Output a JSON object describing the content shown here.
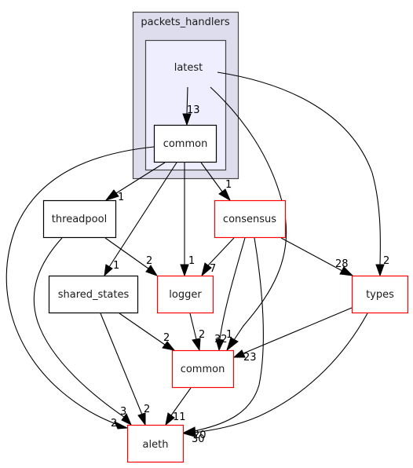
{
  "diagram": {
    "type": "directory-dependency-graph",
    "clusters": [
      {
        "id": "packets_handlers",
        "label": "packets_handlers",
        "fill": "#ddddee"
      },
      {
        "id": "latest",
        "label": "latest",
        "fill": "#eeeeff",
        "parent": "packets_handlers"
      }
    ],
    "nodes": [
      {
        "id": "common_inner",
        "label": "common",
        "border": "#000000",
        "cluster": "latest"
      },
      {
        "id": "threadpool",
        "label": "threadpool",
        "border": "#000000"
      },
      {
        "id": "consensus",
        "label": "consensus",
        "border": "#ff0000"
      },
      {
        "id": "shared_states",
        "label": "shared_states",
        "border": "#000000"
      },
      {
        "id": "logger",
        "label": "logger",
        "border": "#ff0000"
      },
      {
        "id": "types",
        "label": "types",
        "border": "#ff0000"
      },
      {
        "id": "common",
        "label": "common",
        "border": "#ff0000"
      },
      {
        "id": "aleth",
        "label": "aleth",
        "border": "#ff0000"
      }
    ],
    "edges": [
      {
        "from": "latest",
        "to": "common_inner",
        "label": "13"
      },
      {
        "from": "latest",
        "to": "types",
        "label": "2"
      },
      {
        "from": "latest",
        "to": "common",
        "label": "32"
      },
      {
        "from": "common_inner",
        "to": "threadpool",
        "label": "1"
      },
      {
        "from": "common_inner",
        "to": "consensus",
        "label": "1"
      },
      {
        "from": "common_inner",
        "to": "shared_states",
        "label": "1"
      },
      {
        "from": "common_inner",
        "to": "logger",
        "label": "1"
      },
      {
        "from": "common_inner",
        "to": "aleth",
        "label": "2"
      },
      {
        "from": "threadpool",
        "to": "logger",
        "label": "2"
      },
      {
        "from": "threadpool",
        "to": "aleth",
        "label": "3"
      },
      {
        "from": "consensus",
        "to": "logger",
        "label": "7"
      },
      {
        "from": "consensus",
        "to": "types",
        "label": "28"
      },
      {
        "from": "consensus",
        "to": "common",
        "label": "1"
      },
      {
        "from": "consensus",
        "to": "aleth",
        "label": "20"
      },
      {
        "from": "shared_states",
        "to": "common",
        "label": "2"
      },
      {
        "from": "shared_states",
        "to": "aleth",
        "label": "2"
      },
      {
        "from": "logger",
        "to": "common",
        "label": "2"
      },
      {
        "from": "types",
        "to": "common",
        "label": "23"
      },
      {
        "from": "types",
        "to": "aleth",
        "label": "30"
      },
      {
        "from": "common",
        "to": "aleth",
        "label": "11"
      }
    ]
  }
}
